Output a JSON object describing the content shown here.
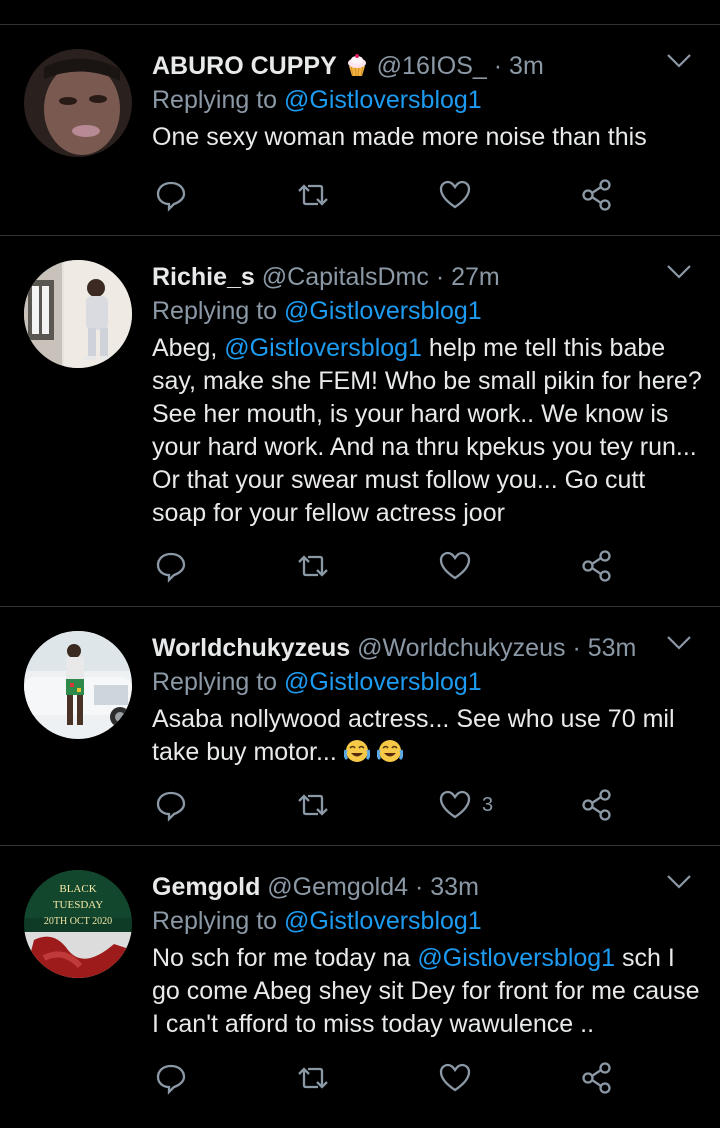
{
  "reply_prefix": "Replying to",
  "tweets": [
    {
      "name": "ABURO CUPPY",
      "name_emoji": "cupcake-emoji",
      "handle": "@16IOS_",
      "dot": "·",
      "time": "3m",
      "reply_to": "@Gistloversblog1",
      "body": "One sexy woman made more noise than this",
      "likes": ""
    },
    {
      "name": "Richie_s",
      "handle": "@CapitalsDmc",
      "dot": "·",
      "time": "27m",
      "reply_to": "@Gistloversblog1",
      "body_pre": "Abeg, ",
      "body_mention": "@Gistloversblog1",
      "body_post": " help me tell this babe say, make she FEM! Who be small pikin for here? See her mouth, is your hard work.. We know is your hard work. And na thru kpekus you tey run... Or that your swear must follow you... Go cutt soap for your fellow actress joor",
      "likes": ""
    },
    {
      "name": "Worldchukyzeus",
      "handle": "@Worldchukyzeus",
      "dot": "·",
      "time": "53m",
      "reply_to": "@Gistloversblog1",
      "body": "Asaba nollywood actress... See who use 70 mil take buy motor... ",
      "body_emoji": "face-with-tears-of-joy-emoji",
      "likes": "3"
    },
    {
      "name": "Gemgold",
      "handle": "@Gemgold4",
      "dot": "·",
      "time": "33m",
      "reply_to": "@Gistloversblog1",
      "body_pre": "No sch for me today na ",
      "body_mention": "@Gistloversblog1",
      "body_post": " sch I go come Abeg shey sit Dey for front for me cause I can't afford to miss today wawulence ..",
      "likes": "",
      "avatar_text": [
        "BLACK",
        "TUESDAY",
        "20TH OCT 2020"
      ]
    }
  ],
  "colors": {
    "background": "#000000",
    "text": "#e7e9ea",
    "muted": "#8b98a5",
    "link": "#1d9bf0",
    "divider": "#2f3336"
  }
}
